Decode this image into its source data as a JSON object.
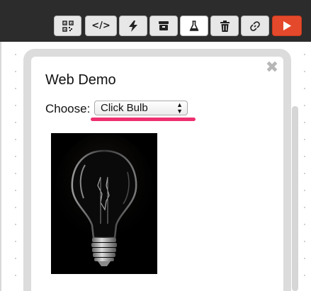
{
  "toolbar": {
    "buttons": [
      {
        "icon": "qr-code-icon"
      },
      {
        "icon": "code-icon",
        "label": "</>"
      },
      {
        "icon": "lightning-icon"
      },
      {
        "icon": "archive-icon"
      },
      {
        "icon": "flask-icon",
        "active": true
      },
      {
        "icon": "trash-icon"
      },
      {
        "icon": "link-icon"
      },
      {
        "icon": "play-icon"
      }
    ],
    "run_color": "#e4492b"
  },
  "panel": {
    "title": "Web Demo",
    "close_symbol": "✖",
    "choose_label": "Choose:",
    "select": {
      "selected": "Click Bulb",
      "arrows": "▲▼"
    },
    "highlight_color": "#ee2f6f",
    "image": {
      "icon": "light-bulb-image"
    }
  }
}
